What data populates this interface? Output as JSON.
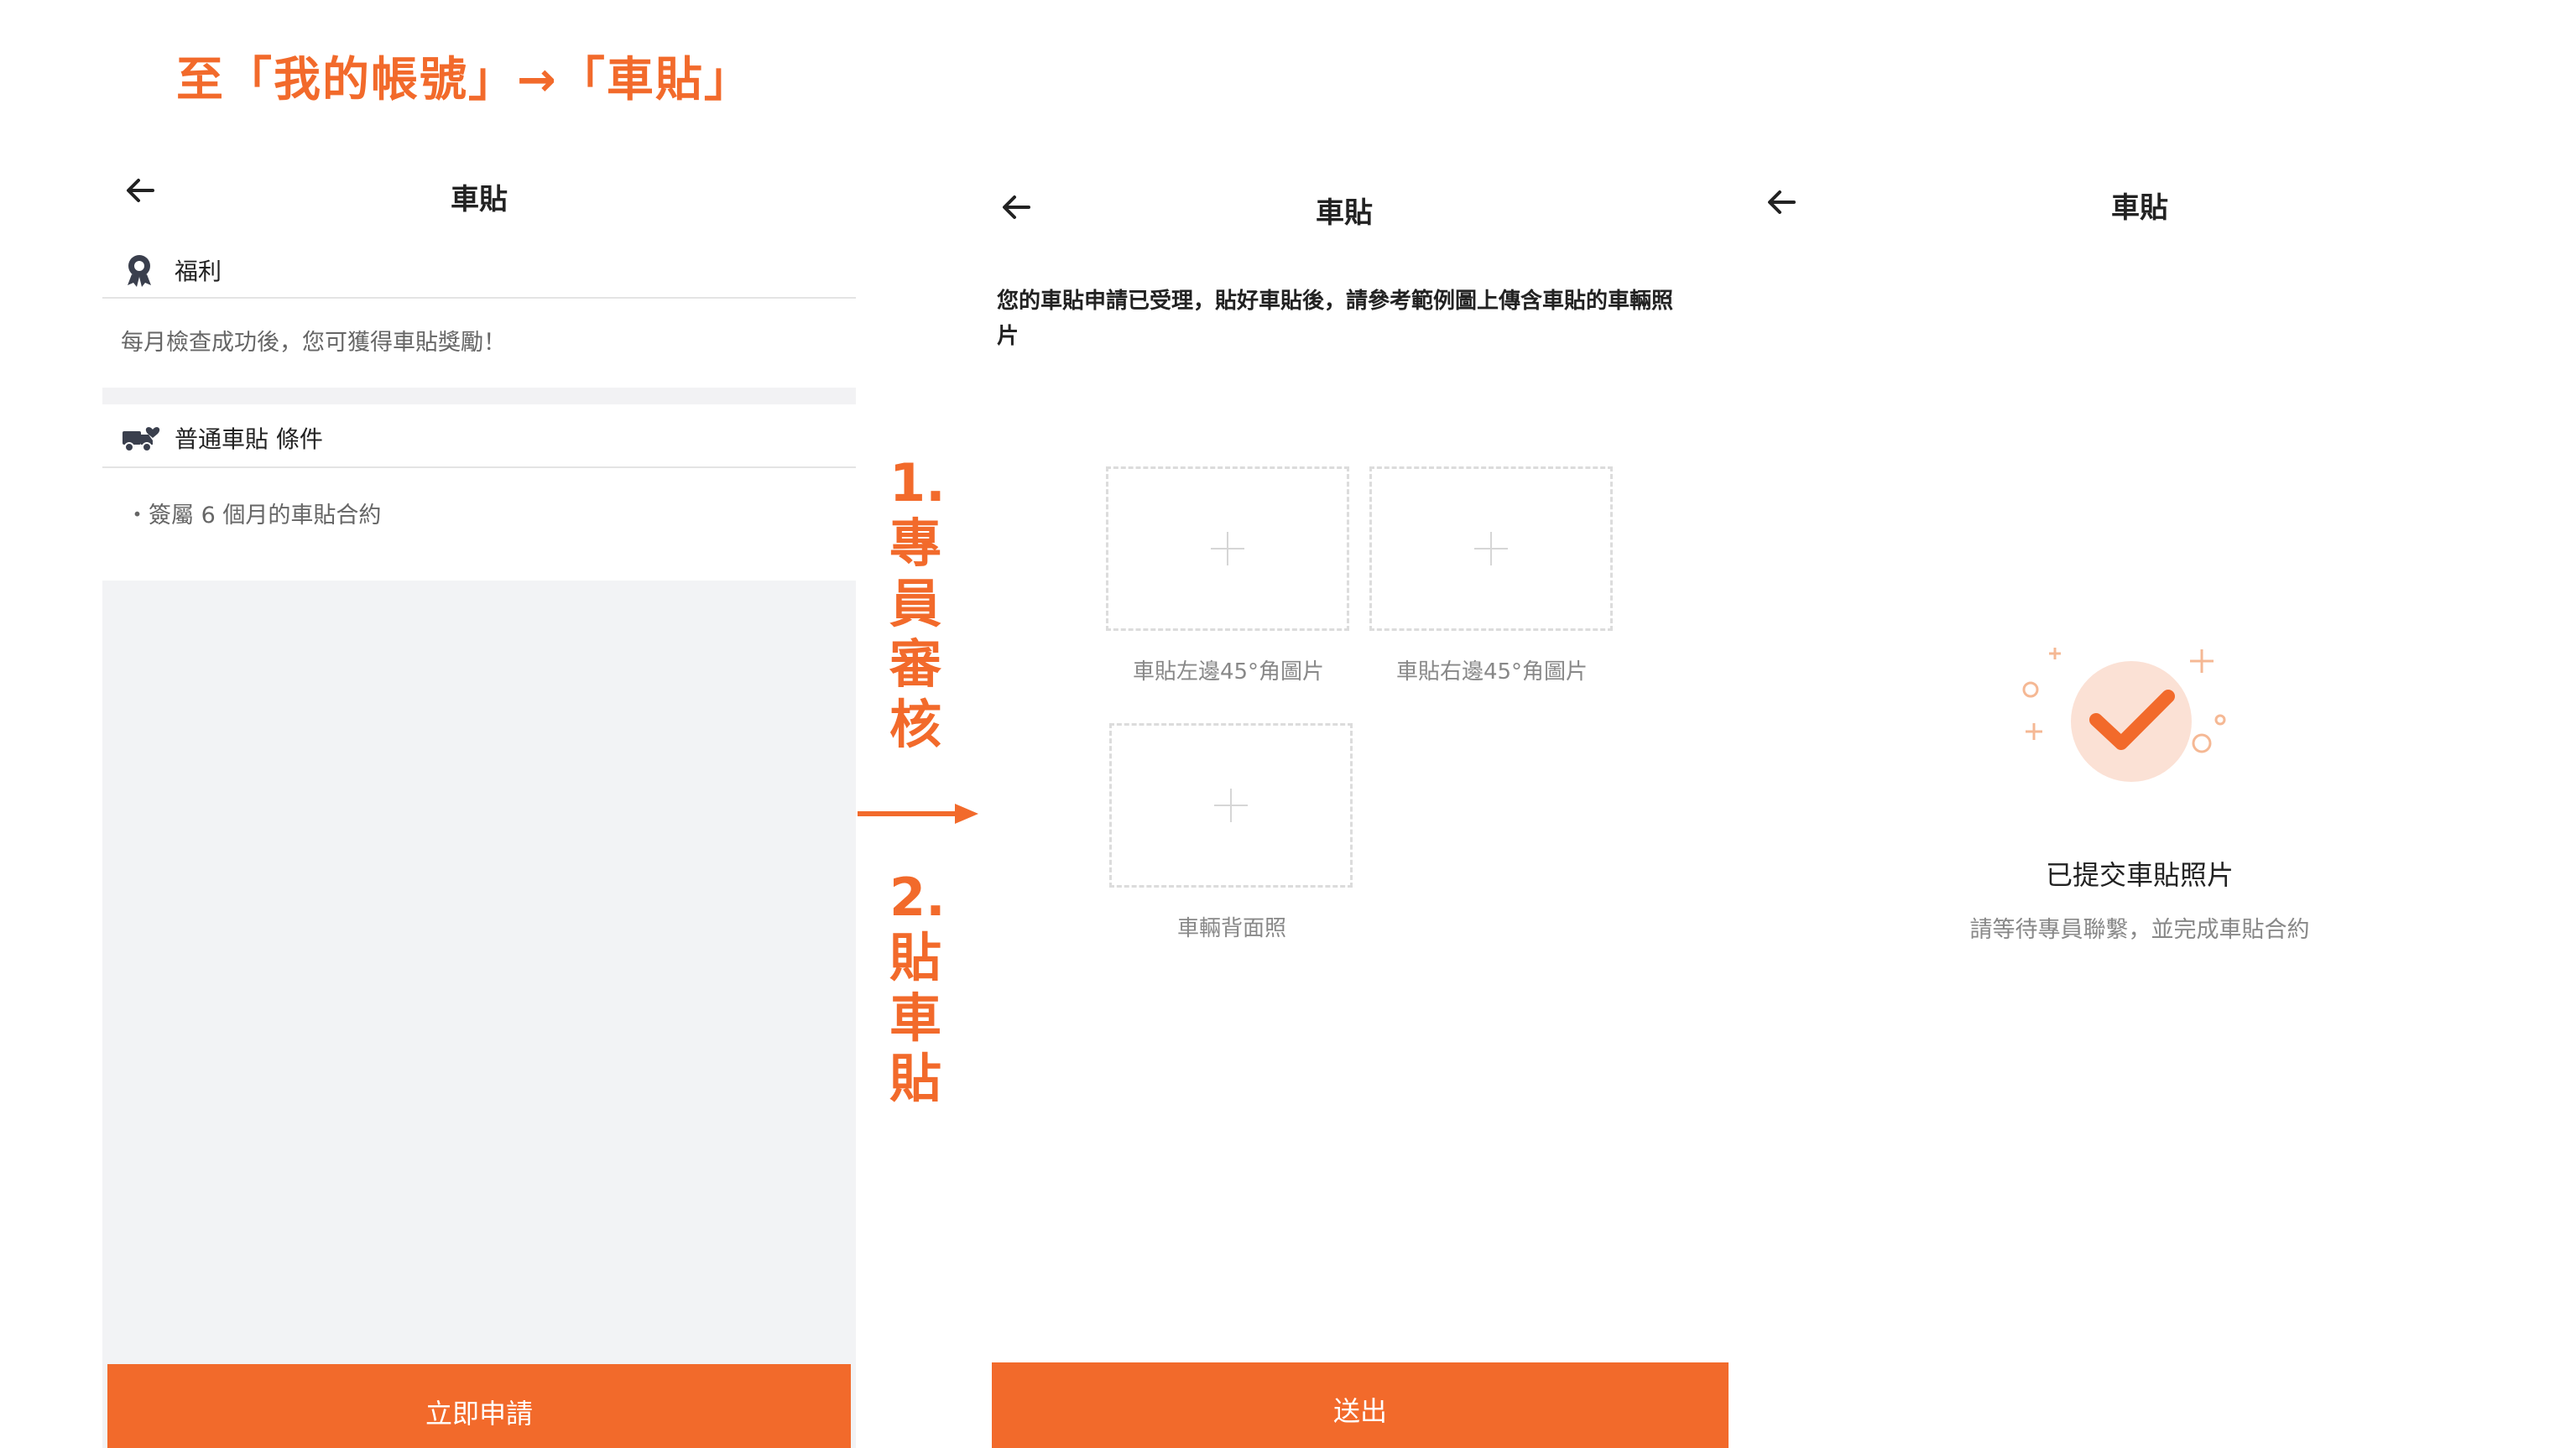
{
  "heading": "至「我的帳號」→「車貼」",
  "screen1": {
    "title": "車貼",
    "benefit_label": "福利",
    "benefit_text": "每月檢查成功後，您可獲得車貼獎勵！",
    "condition_label": "普通車貼 條件",
    "condition_item": "・簽屬 6 個月的車貼合約",
    "apply_button": "立即申請"
  },
  "steps": {
    "step1_number": "1.",
    "step1_chars": [
      "專",
      "員",
      "審",
      "核"
    ],
    "step2_number": "2.",
    "step2_chars": [
      "貼",
      "車",
      "貼"
    ]
  },
  "screen2": {
    "title": "車貼",
    "notice": "您的車貼申請已受理，貼好車貼後，請參考範例圖上傳含車貼的車輛照片",
    "upload_left_caption": "車貼左邊45°角圖片",
    "upload_right_caption": "車貼右邊45°角圖片",
    "upload_back_caption": "車輛背面照",
    "submit_button": "送出"
  },
  "screen3": {
    "title": "車貼",
    "success_title": "已提交車貼照片",
    "success_subtitle": "請等待專員聯繫，並完成車貼合約"
  },
  "colors": {
    "accent": "#f26a2b",
    "page_bg": "#ffffff",
    "panel_gray": "#f2f3f5",
    "success_circle": "#fbe1d5"
  },
  "icons": [
    "back-arrow-icon",
    "award-ribbon-icon",
    "truck-heart-icon",
    "plus-icon",
    "check-icon",
    "long-right-arrow-icon"
  ]
}
